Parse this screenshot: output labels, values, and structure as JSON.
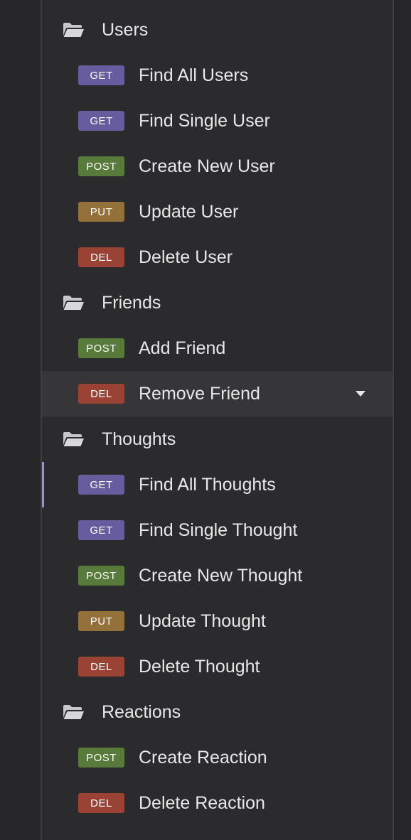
{
  "colors": {
    "GET": "#675d9e",
    "POST": "#587a3a",
    "PUT": "#94703a",
    "DEL": "#9a4234",
    "active_indicator": "#9f8cf5"
  },
  "folders": [
    {
      "name": "Users",
      "icon": "folder-open-icon",
      "requests": [
        {
          "method": "GET",
          "label": "Find All Users"
        },
        {
          "method": "GET",
          "label": "Find Single User"
        },
        {
          "method": "POST",
          "label": "Create New User"
        },
        {
          "method": "PUT",
          "label": "Update User"
        },
        {
          "method": "DEL",
          "label": "Delete User"
        }
      ]
    },
    {
      "name": "Friends",
      "icon": "folder-open-icon",
      "requests": [
        {
          "method": "POST",
          "label": "Add Friend"
        },
        {
          "method": "DEL",
          "label": "Remove Friend",
          "hovered": true,
          "menu_icon": "caret-down-icon"
        }
      ]
    },
    {
      "name": "Thoughts",
      "icon": "folder-open-icon",
      "requests": [
        {
          "method": "GET",
          "label": "Find All Thoughts",
          "active": true
        },
        {
          "method": "GET",
          "label": "Find Single Thought"
        },
        {
          "method": "POST",
          "label": "Create New Thought"
        },
        {
          "method": "PUT",
          "label": "Update Thought"
        },
        {
          "method": "DEL",
          "label": "Delete Thought"
        }
      ]
    },
    {
      "name": "Reactions",
      "icon": "folder-open-icon",
      "requests": [
        {
          "method": "POST",
          "label": "Create Reaction"
        },
        {
          "method": "DEL",
          "label": "Delete Reaction"
        }
      ]
    }
  ]
}
